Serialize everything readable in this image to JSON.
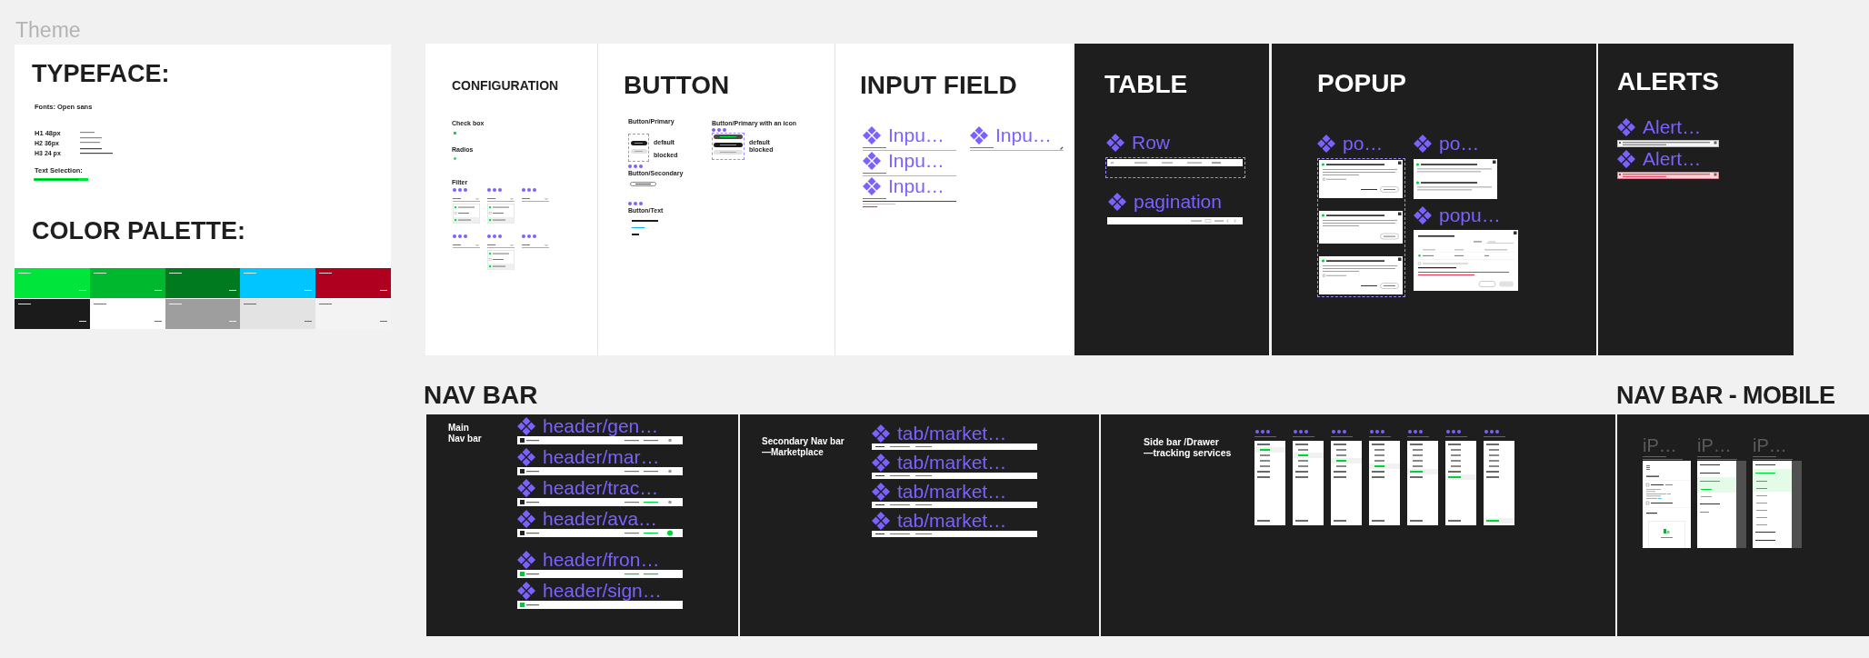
{
  "canvas": {
    "title": "Theme"
  },
  "theme": {
    "typeface_title": "TYPEFACE:",
    "fonts_label": "Fonts: Open sans",
    "type_scale": [
      "H1 48px",
      "H2 36px",
      "H3 24 px"
    ],
    "selection_label": "Text Selection:",
    "palette_title": "COLOR PALETTE:",
    "swatches": [
      {
        "color": "#00e53b"
      },
      {
        "color": "#00b82e"
      },
      {
        "color": "#007a1f"
      },
      {
        "color": "#00c5ff"
      },
      {
        "color": "#b0001f"
      },
      {
        "color": "#1b1b1b"
      },
      {
        "color": "#ffffff"
      },
      {
        "color": "#9e9e9e"
      },
      {
        "color": "#e3e3e3"
      },
      {
        "color": "#f3f3f3"
      }
    ]
  },
  "configuration": {
    "title": "CONFIGURATION",
    "checkbox_label": "Check box",
    "checkbox": {
      "checked": true
    },
    "radio_label": "Radios",
    "radio": {
      "selected": true
    },
    "filter_label": "Filter",
    "filters": [
      {
        "expanded": true
      },
      {
        "expanded": true
      },
      {
        "expanded": false
      },
      {
        "expanded": false
      },
      {
        "expanded": true
      },
      {
        "expanded": false
      }
    ]
  },
  "button": {
    "title": "BUTTON",
    "groups": [
      {
        "label": "Button/Primary",
        "buttons": [
          {
            "kind": "default"
          },
          {
            "kind": "blocked"
          }
        ],
        "states": [
          "default",
          "blocked"
        ]
      },
      {
        "label": "Button/Primary with an icon",
        "buttons": [
          {
            "kind": "hover"
          },
          {
            "kind": "default"
          },
          {
            "kind": "blocked"
          }
        ],
        "states": [
          "default",
          "blocked"
        ]
      }
    ],
    "secondary_label": "Button/Secondary",
    "text_label": "Button/Text",
    "text_buttons": [
      {
        "color": "#1b1b1b"
      },
      {
        "color": "#00b4e6"
      },
      {
        "color": "#1b1b1b"
      }
    ]
  },
  "input_field": {
    "title": "INPUT FIELD",
    "columns": [
      [
        {
          "label": "Inpu…",
          "error": false,
          "editable": false
        },
        {
          "label": "Inpu…",
          "error": false,
          "editable": false
        },
        {
          "label": "Inpu…",
          "error": true,
          "editable": false
        }
      ],
      [
        {
          "label": "Inpu…",
          "error": false,
          "editable": true
        }
      ]
    ]
  },
  "table": {
    "title": "TABLE",
    "row": {
      "label": "Row"
    },
    "pagination": {
      "label": "pagination"
    }
  },
  "popup": {
    "title": "POPUP",
    "guide": {
      "label": "po…",
      "cards": [
        {
          "kind": "checkbox"
        },
        {
          "kind": "plain"
        },
        {
          "kind": "checkbox"
        }
      ]
    },
    "info": {
      "label": "po…"
    },
    "tasks": {
      "label": "popu…"
    }
  },
  "alerts": {
    "title": "ALERTS",
    "items": [
      {
        "label": "Alert…",
        "kind": "info"
      },
      {
        "label": "Alert…",
        "kind": "warning"
      }
    ]
  },
  "nav_bar": {
    "title": "NAV BAR",
    "main": {
      "title": "Main\nNav bar",
      "groups": [
        [
          {
            "label": "header/gen…",
            "kind": "general"
          },
          {
            "label": "header/mar…",
            "kind": "marketplace"
          },
          {
            "label": "header/trac…",
            "kind": "tracking"
          },
          {
            "label": "header/ava…",
            "kind": "avatar"
          }
        ],
        [
          {
            "label": "header/fron…",
            "kind": "front"
          },
          {
            "label": "header/sign…",
            "kind": "signup"
          }
        ]
      ]
    },
    "secondary": {
      "title": "Secondary Nav bar\n—Marketplace",
      "tabs": [
        {
          "label": "tab/market…"
        },
        {
          "label": "tab/market…"
        },
        {
          "label": "tab/market…"
        },
        {
          "label": "tab/market…"
        }
      ]
    },
    "sidebar": {
      "title": "Side bar /Drawer\n—tracking services",
      "drawers": [
        {
          "items": [
            {
              "selected": false,
              "children": [
                {
                  "selected": true
                },
                {
                  "selected": false
                },
                {
                  "selected": false
                },
                {
                  "selected": false
                }
              ]
            },
            {
              "selected": false
            },
            {
              "selected": false
            }
          ],
          "footer": {
            "selected": false
          }
        },
        {
          "items": [
            {
              "selected": false,
              "children": [
                {
                  "selected": false
                },
                {
                  "selected": true
                },
                {
                  "selected": false
                },
                {
                  "selected": false
                }
              ]
            },
            {
              "selected": false
            },
            {
              "selected": false
            }
          ],
          "footer": {
            "selected": false
          }
        },
        {
          "items": [
            {
              "selected": false,
              "children": [
                {
                  "selected": false
                },
                {
                  "selected": false
                },
                {
                  "selected": true
                },
                {
                  "selected": false
                }
              ]
            },
            {
              "selected": false
            },
            {
              "selected": false
            }
          ],
          "footer": {
            "selected": false
          }
        },
        {
          "items": [
            {
              "selected": false,
              "children": [
                {
                  "selected": false
                },
                {
                  "selected": false
                },
                {
                  "selected": false
                },
                {
                  "selected": true
                }
              ]
            },
            {
              "selected": false
            },
            {
              "selected": false
            }
          ],
          "footer": {
            "selected": false
          }
        },
        {
          "items": [
            {
              "selected": false,
              "children": [
                {
                  "selected": false
                },
                {
                  "selected": false
                },
                {
                  "selected": false
                },
                {
                  "selected": false
                }
              ]
            },
            {
              "selected": true
            },
            {
              "selected": false
            }
          ],
          "footer": {
            "selected": false
          }
        },
        {
          "items": [
            {
              "selected": false,
              "children": [
                {
                  "selected": false
                },
                {
                  "selected": false
                },
                {
                  "selected": false
                },
                {
                  "selected": false
                }
              ]
            },
            {
              "selected": false
            },
            {
              "selected": true
            }
          ],
          "footer": {
            "selected": false
          }
        },
        {
          "items": [
            {
              "selected": false,
              "children": [
                {
                  "selected": false
                },
                {
                  "selected": false
                },
                {
                  "selected": false
                },
                {
                  "selected": false
                }
              ]
            },
            {
              "selected": false
            },
            {
              "selected": false
            }
          ],
          "footer": {
            "selected": true
          }
        }
      ]
    }
  },
  "mobile_nav": {
    "title": "NAV BAR - MOBILE",
    "screens": [
      {
        "label": "iP…",
        "kind": "home"
      },
      {
        "label": "iP…",
        "kind": "menu",
        "items": [
          {
            "kind": "top",
            "selected": false
          },
          {
            "kind": "top",
            "selected": false
          },
          {
            "kind": "top",
            "selected": true
          },
          {
            "kind": "sub",
            "selected": true
          },
          {
            "kind": "sub",
            "selected": false
          },
          {
            "kind": "top",
            "selected": false
          },
          {
            "kind": "link",
            "selected": false
          }
        ]
      },
      {
        "label": "iP…",
        "kind": "menu",
        "items": [
          {
            "kind": "top",
            "selected": false
          },
          {
            "kind": "top",
            "selected": true
          },
          {
            "kind": "sub",
            "selected": true
          },
          {
            "kind": "sub",
            "selected": true
          },
          {
            "kind": "sub",
            "selected": false
          },
          {
            "kind": "sub",
            "selected": false
          },
          {
            "kind": "sub",
            "selected": false
          },
          {
            "kind": "sub",
            "selected": false
          },
          {
            "kind": "sub",
            "selected": false
          },
          {
            "kind": "top",
            "selected": false
          },
          {
            "kind": "top",
            "selected": false
          }
        ]
      }
    ]
  }
}
